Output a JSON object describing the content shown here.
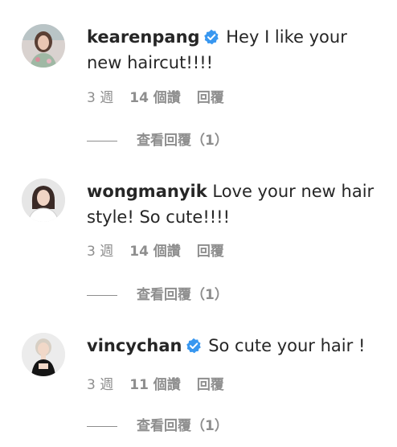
{
  "comments": [
    {
      "username": "kearenpang",
      "verified": true,
      "text": "Hey I like your new haircut!!!!",
      "time": "3 週",
      "likes": "14 個讚",
      "reply_label": "回覆",
      "view_replies": "查看回覆（1）"
    },
    {
      "username": "wongmanyik",
      "verified": false,
      "text": "Love your new hair style! So cute!!!!",
      "time": "3 週",
      "likes": "14 個讚",
      "reply_label": "回覆",
      "view_replies": "查看回覆（1）"
    },
    {
      "username": "vincychan",
      "verified": true,
      "text": "So cute your hair !",
      "time": "3 週",
      "likes": "11 個讚",
      "reply_label": "回覆",
      "view_replies": "查看回覆（1）"
    }
  ],
  "colors": {
    "text": "#262626",
    "secondary": "#8e8e8e",
    "verified_badge": "#3897f0"
  },
  "icons": {
    "verified": "verified-badge-icon"
  }
}
